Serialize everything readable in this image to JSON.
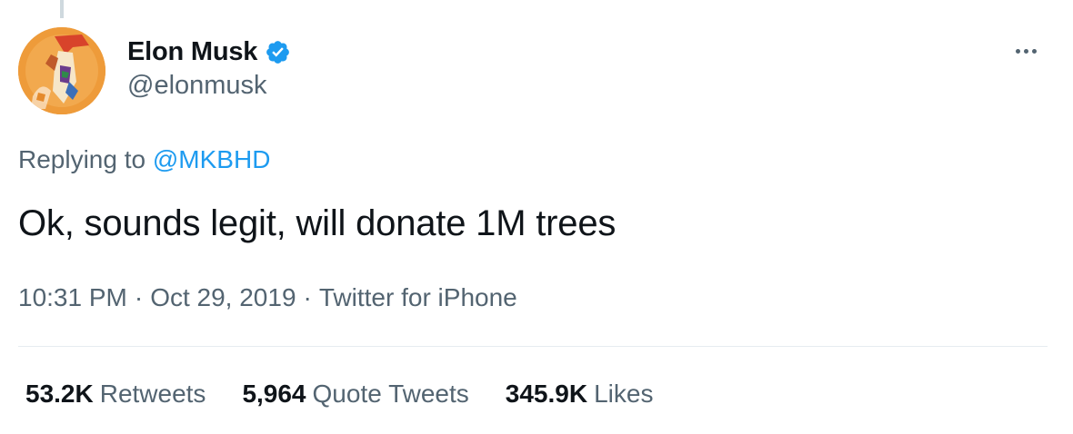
{
  "author": {
    "display_name": "Elon Musk",
    "handle": "@elonmusk",
    "verified": true,
    "avatar_icon": "avatar-illustration"
  },
  "reply": {
    "prefix": "Replying to",
    "target": "@MKBHD"
  },
  "tweet": {
    "text": "Ok, sounds legit, will donate 1M trees",
    "time": "10:31 PM",
    "date": "Oct 29, 2019",
    "source": "Twitter for iPhone",
    "separator": "·"
  },
  "stats": [
    {
      "value": "53.2K",
      "label": "Retweets"
    },
    {
      "value": "5,964",
      "label": "Quote Tweets"
    },
    {
      "value": "345.9K",
      "label": "Likes"
    }
  ],
  "colors": {
    "text": "#0f1419",
    "secondary": "#536471",
    "link": "#1d9bf0",
    "verified": "#1d9bf0",
    "divider": "#e6ecf0"
  },
  "icons": {
    "verified": "verified-badge-icon",
    "more": "more-horizontal-icon"
  }
}
